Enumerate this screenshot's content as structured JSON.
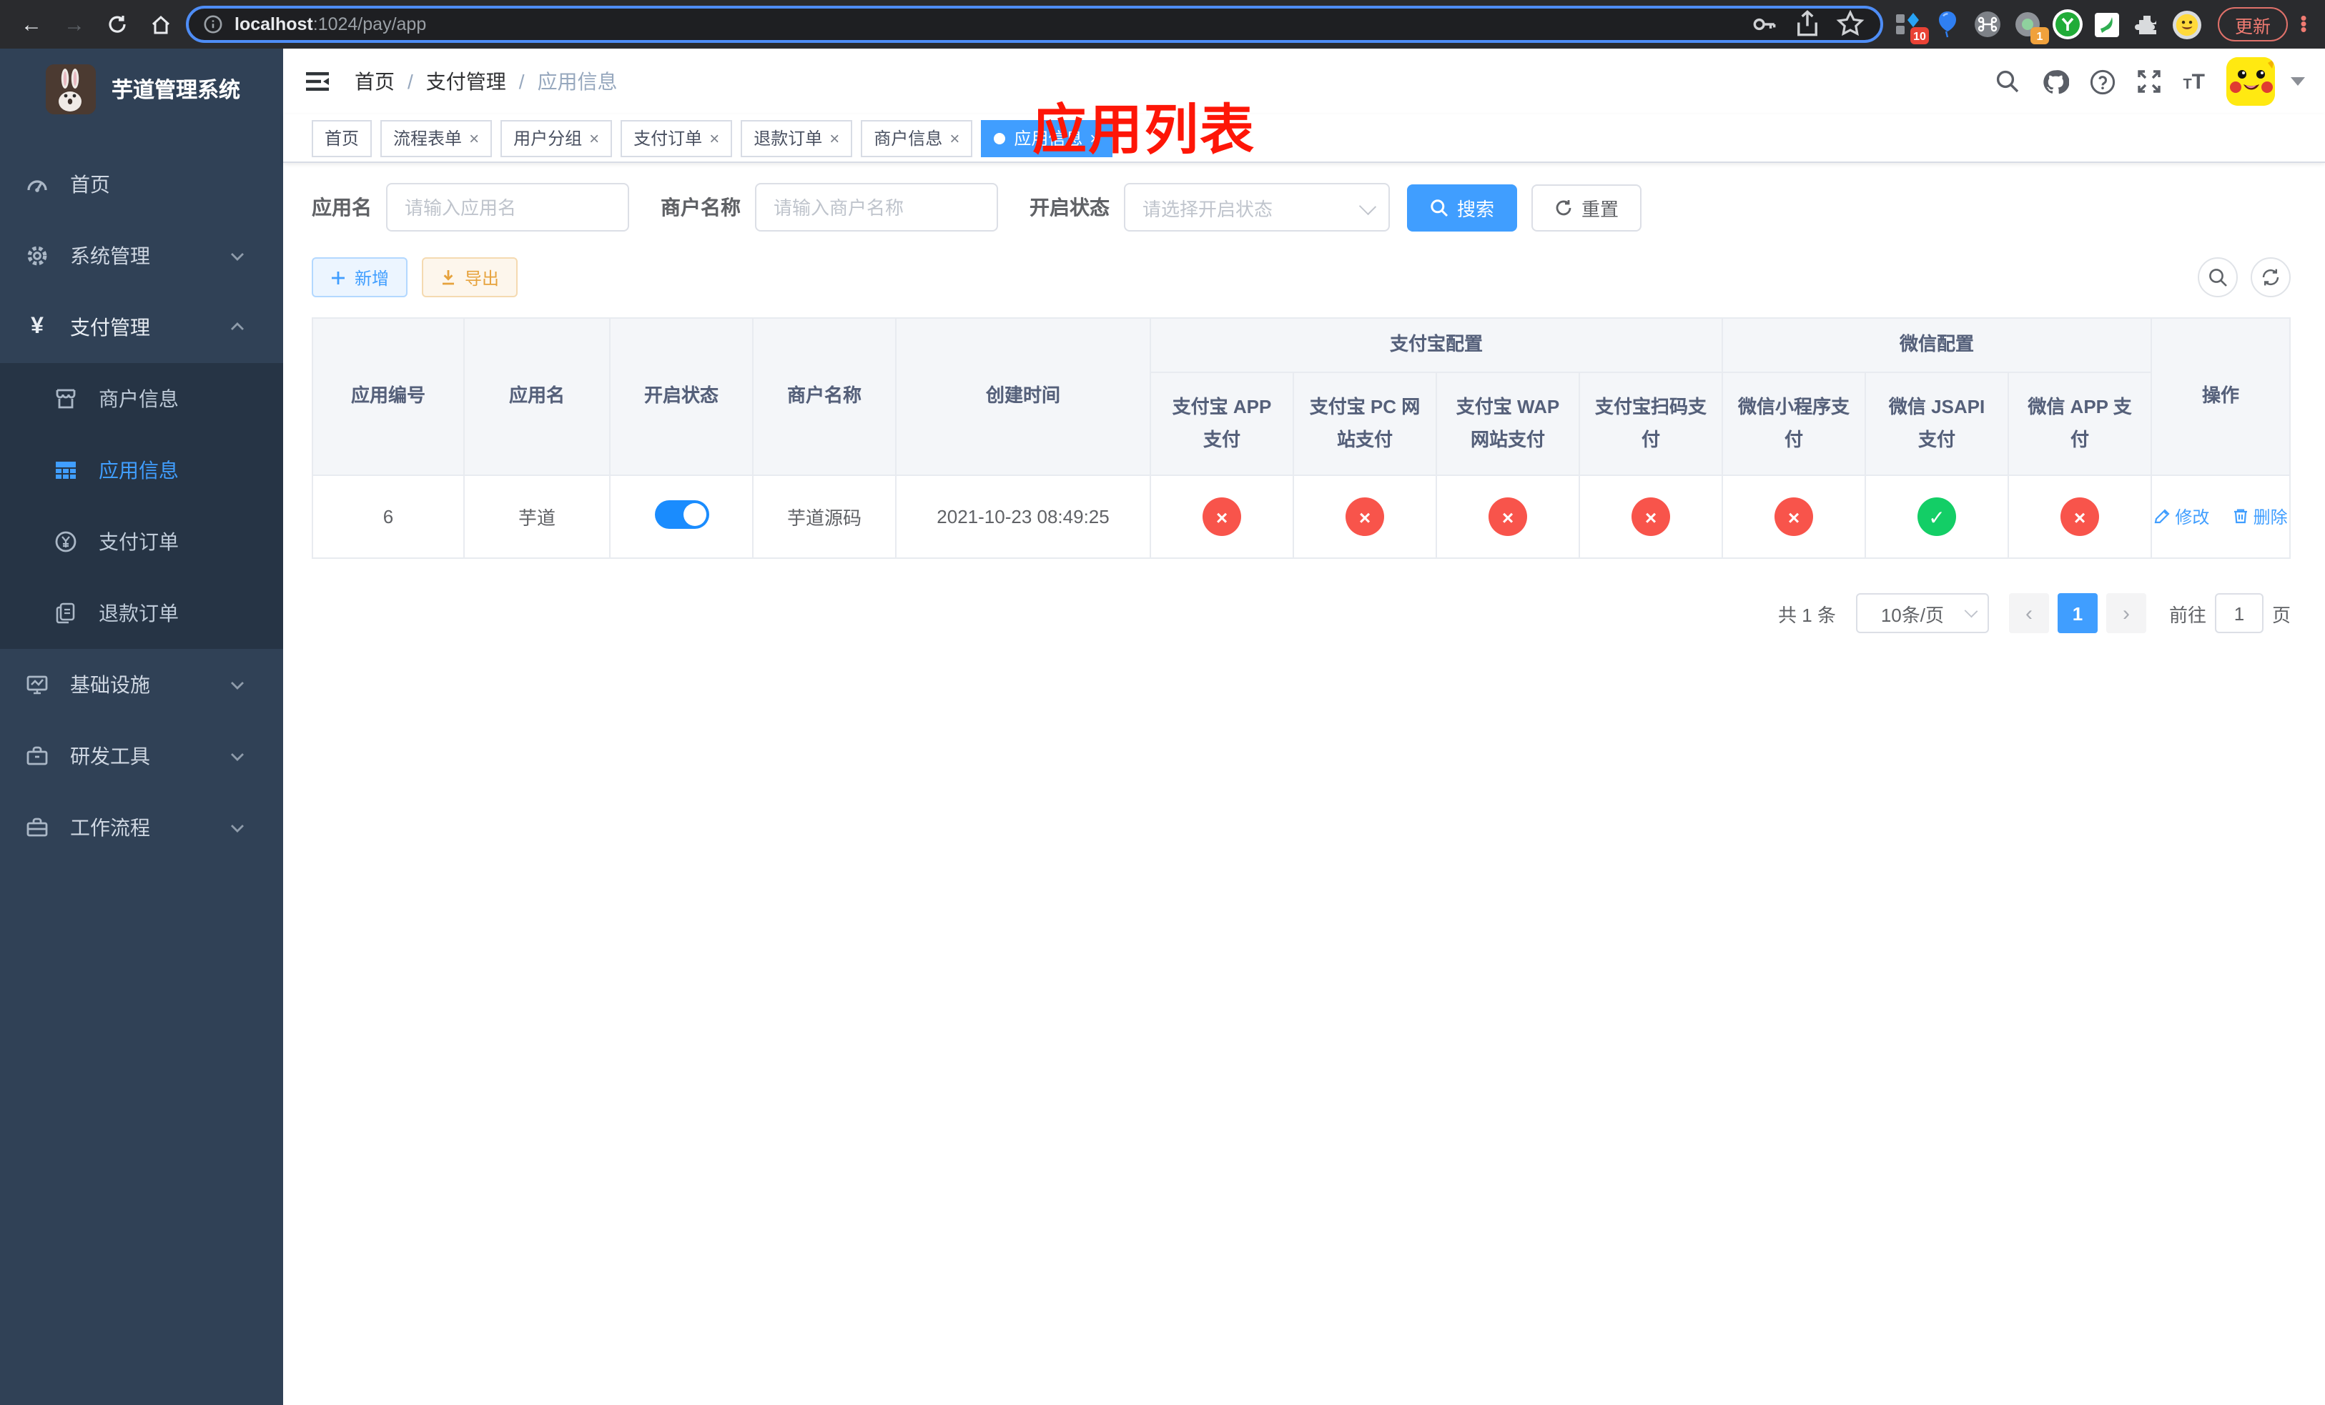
{
  "browser": {
    "url_host": "localhost",
    "url_rest": ":1024/pay/app",
    "update_label": "更新",
    "ext_badge_blue_diamond": "10",
    "ext_badge_record": "1"
  },
  "sidebar": {
    "title": "芋道管理系统",
    "menu": [
      {
        "label": "首页",
        "icon": "dashboard-icon"
      },
      {
        "label": "系统管理",
        "icon": "gear-icon",
        "state": "collapsed"
      },
      {
        "label": "支付管理",
        "icon": "yen-icon",
        "state": "expanded",
        "children": [
          {
            "label": "商户信息",
            "icon": "shop-icon"
          },
          {
            "label": "应用信息",
            "icon": "grid-icon",
            "active": true
          },
          {
            "label": "支付订单",
            "icon": "yen-circle-icon"
          },
          {
            "label": "退款订单",
            "icon": "refund-docs-icon"
          }
        ]
      },
      {
        "label": "基础设施",
        "icon": "monitor-icon",
        "state": "collapsed"
      },
      {
        "label": "研发工具",
        "icon": "toolbox-icon",
        "state": "collapsed"
      },
      {
        "label": "工作流程",
        "icon": "workflow-icon",
        "state": "collapsed"
      }
    ]
  },
  "breadcrumb": {
    "items": [
      "首页",
      "支付管理",
      "应用信息"
    ],
    "separator": "/"
  },
  "annotation": "应用列表",
  "tabs": [
    {
      "label": "首页",
      "closable": false,
      "active": false
    },
    {
      "label": "流程表单",
      "closable": true,
      "active": false
    },
    {
      "label": "用户分组",
      "closable": true,
      "active": false
    },
    {
      "label": "支付订单",
      "closable": true,
      "active": false
    },
    {
      "label": "退款订单",
      "closable": true,
      "active": false
    },
    {
      "label": "商户信息",
      "closable": true,
      "active": false
    },
    {
      "label": "应用信息",
      "closable": true,
      "active": true
    }
  ],
  "filters": {
    "app_name": {
      "label": "应用名",
      "placeholder": "请输入应用名",
      "value": ""
    },
    "merchant_name": {
      "label": "商户名称",
      "placeholder": "请输入商户名称",
      "value": ""
    },
    "status": {
      "label": "开启状态",
      "placeholder": "请选择开启状态",
      "value": ""
    },
    "search_label": "搜索",
    "reset_label": "重置"
  },
  "toolbar": {
    "add_label": "新增",
    "export_label": "导出"
  },
  "table": {
    "plain_columns": [
      "应用编号",
      "应用名",
      "开启状态",
      "商户名称",
      "创建时间"
    ],
    "groups": [
      {
        "label": "支付宝配置",
        "children": [
          "支付宝 APP 支付",
          "支付宝 PC 网站支付",
          "支付宝 WAP 网站支付",
          "支付宝扫码支付"
        ]
      },
      {
        "label": "微信配置",
        "children": [
          "微信小程序支付",
          "微信 JSAPI 支付",
          "微信 APP 支付"
        ]
      }
    ],
    "op_column": "操作",
    "row": {
      "id": "6",
      "name": "芋道",
      "enabled": true,
      "merchant": "芋道源码",
      "created": "2021-10-23 08:49:25",
      "channels": [
        false,
        false,
        false,
        false,
        false,
        true,
        false
      ],
      "edit_label": "修改",
      "delete_label": "删除"
    }
  },
  "pagination": {
    "total_text": "共 1 条",
    "page_size": "10条/页",
    "current_page": "1",
    "goto_label": "前往",
    "goto_value": "1",
    "page_suffix": "页"
  },
  "icons": {
    "check": "✓",
    "cross": "×",
    "plus": "＋",
    "close": "×"
  },
  "colors": {
    "primary": "#409eff",
    "sidebar_bg": "#304156",
    "submenu_bg": "#263445",
    "danger_circle": "#f8544b",
    "success_circle": "#13ce66",
    "annotation_red": "#fe1607",
    "toggle_on": "#1a8cfe"
  }
}
